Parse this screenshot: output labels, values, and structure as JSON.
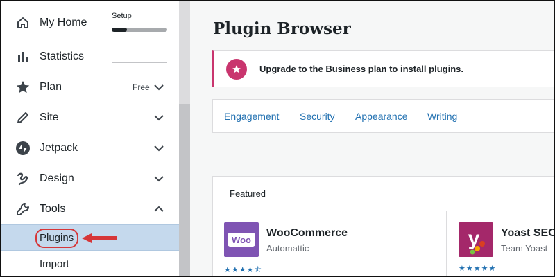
{
  "sidebar": {
    "setup": {
      "label": "Setup",
      "progress": 0.28
    },
    "items": [
      {
        "label": "My Home",
        "icon": "home-icon"
      },
      {
        "label": "Statistics",
        "icon": "bar-chart-icon"
      },
      {
        "label": "Plan",
        "icon": "star-icon",
        "tag": "Free"
      },
      {
        "label": "Site",
        "icon": "pencil-icon"
      },
      {
        "label": "Jetpack",
        "icon": "jetpack-icon"
      },
      {
        "label": "Design",
        "icon": "design-icon"
      },
      {
        "label": "Tools",
        "icon": "wrench-icon"
      }
    ],
    "subitems": [
      {
        "label": "Plugins"
      },
      {
        "label": "Import"
      }
    ]
  },
  "main": {
    "title": "Plugin Browser",
    "notice": {
      "text": "Upgrade to the Business plan to install plugins.",
      "icon": "star-icon",
      "color": "#c9356e"
    },
    "tabs": [
      "Engagement",
      "Security",
      "Appearance",
      "Writing"
    ],
    "featured": {
      "title": "Featured",
      "plugins": [
        {
          "name": "WooCommerce",
          "author": "Automattic",
          "rating": 4.5,
          "stars": "★★★★⯪",
          "logo_color": "#7f54b3",
          "logo_text": "Woo"
        },
        {
          "name": "Yoast SEO",
          "author": "Team Yoast",
          "rating": 5,
          "stars": "★★★★★",
          "logo_color": "#a4286a",
          "logo_text": "y"
        }
      ]
    }
  },
  "colors": {
    "accent": "#2271b1",
    "notice": "#c9356e",
    "highlight": "#c5d9ed",
    "callout": "#d63638"
  }
}
